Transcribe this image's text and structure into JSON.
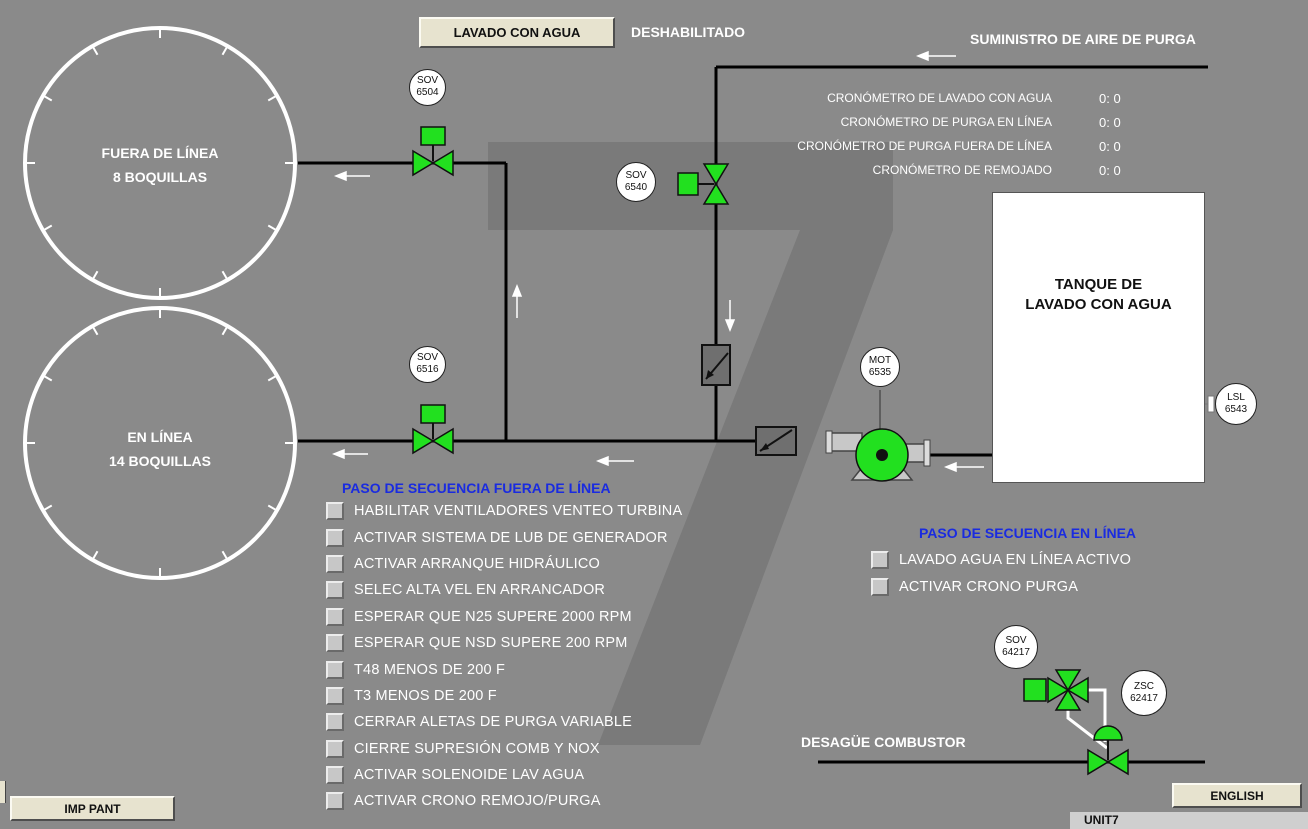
{
  "header": {
    "wash_button_label": "LAVADO CON AGUA",
    "wash_status": "DESHABILITADO",
    "purge_supply_label": "SUMINISTRO DE AIRE DE PURGA"
  },
  "timers": [
    {
      "label": "CRONÓMETRO DE LAVADO CON AGUA",
      "value": "0:  0"
    },
    {
      "label": "CRONÓMETRO DE PURGA EN LÍNEA",
      "value": "0:  0"
    },
    {
      "label": "CRONÓMETRO DE PURGA FUERA DE LÍNEA",
      "value": "0:  0"
    },
    {
      "label": "CRONÓMETRO DE REMOJADO",
      "value": "0:  0"
    }
  ],
  "manifolds": {
    "offline": {
      "line1": "FUERA DE LÍNEA",
      "line2": "8 BOQUILLAS"
    },
    "online": {
      "line1": "EN LÍNEA",
      "line2": "14 BOQUILLAS"
    }
  },
  "instruments": {
    "sov6504": {
      "a": "SOV",
      "b": "6504"
    },
    "sov6516": {
      "a": "SOV",
      "b": "6516"
    },
    "sov6540": {
      "a": "SOV",
      "b": "6540"
    },
    "mot6535": {
      "a": "MOT",
      "b": "6535"
    },
    "lsl6543": {
      "a": "LSL",
      "b": "6543"
    },
    "sov64217": {
      "a": "SOV",
      "b": "64217"
    },
    "zsc62417": {
      "a": "ZSC",
      "b": "62417"
    }
  },
  "tank": {
    "title": "TANQUE DE\nLAVADO CON AGUA"
  },
  "offline_sequence": {
    "title": "PASO DE SECUENCIA FUERA DE LÍNEA",
    "steps": [
      "HABILITAR VENTILADORES VENTEO TURBINA",
      "ACTIVAR SISTEMA DE LUB DE GENERADOR",
      "ACTIVAR ARRANQUE HIDRÁULICO",
      "SELEC ALTA VEL EN ARRANCADOR",
      "ESPERAR QUE N25 SUPERE 2000 RPM",
      "ESPERAR QUE NSD SUPERE 200 RPM",
      "T48 MENOS DE 200 F",
      "T3 MENOS DE 200 F",
      "CERRAR ALETAS DE PURGA VARIABLE",
      "CIERRE SUPRESIÓN COMB Y NOX",
      "ACTIVAR SOLENOIDE LAV AGUA",
      "ACTIVAR CRONO REMOJO/PURGA"
    ]
  },
  "online_sequence": {
    "title": "PASO DE SECUENCIA EN LÍNEA",
    "steps": [
      "LAVADO AGUA EN LÍNEA ACTIVO",
      "ACTIVAR CRONO PURGA"
    ]
  },
  "drain_label": "DESAGÜE COMBUSTOR",
  "footer": {
    "print_button": "IMP PANT",
    "language_button": "ENGLISH",
    "unit_label": "UNIT7"
  },
  "colors": {
    "background": "#8a8a8a",
    "valve_active": "#22e01f",
    "sequence_title": "#1a2be0",
    "button_face": "#e7e3cf"
  }
}
